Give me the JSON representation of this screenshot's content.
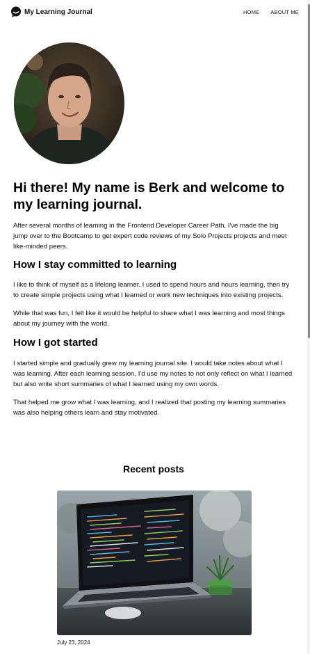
{
  "header": {
    "site_title": "My Learning Journal",
    "logo_icon": "chat-bubble-icon",
    "nav": [
      {
        "label": "HOME"
      },
      {
        "label": "ABOUT ME"
      }
    ]
  },
  "hero": {
    "image_alt": "Portrait of Berk"
  },
  "intro": {
    "heading": "Hi there! My name is Berk and welcome to my learning journal.",
    "paragraph": "After several months of learning in the Frontend Developer Career Path, I've made the big jump over to the Bootcamp to get expert code reviews of my Solo Projects projects and meet like-minded peers."
  },
  "section_committed": {
    "heading": "How I stay committed to learning",
    "paragraphs": [
      "I like to think of myself as a lifelong learner. I used to spend hours and hours learning, then try to create simple projects using what I learned or work new techniques into existing projects.",
      "While that was fun, I felt like it would be helpful to share what I was learning and most things about my journey with the world."
    ]
  },
  "section_started": {
    "heading": "How I got started",
    "paragraphs": [
      "I started simple and gradually grew my learning journal site. I would take notes about what I was learning. After each learning session, I'd use my notes to not only reflect on what I learned but also write short summaries of what I learned using my own words.",
      "That helped me grow what I was learning, and I realized that posting my learning summaries was also helping others learn and stay motivated."
    ]
  },
  "recent_posts": {
    "title": "Recent posts",
    "posts": [
      {
        "date": "July 23, 2024",
        "image_alt": "Laptop with code on screen next to a small plant"
      }
    ]
  },
  "colors": {
    "text": "#111111",
    "background": "#ffffff"
  }
}
